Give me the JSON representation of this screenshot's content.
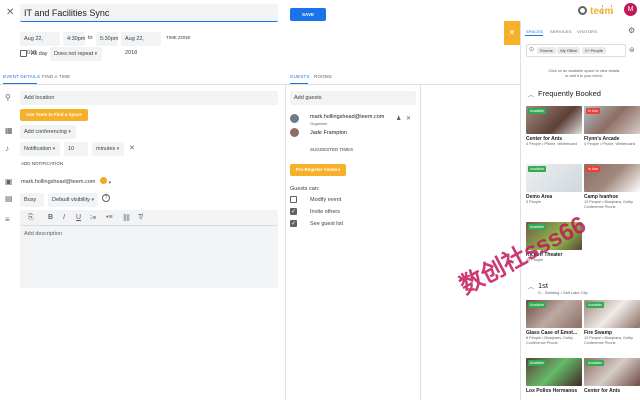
{
  "event": {
    "title": "IT and Facilities Sync",
    "save_label": "SAVE",
    "start_date": "Aug 22, 2018",
    "start_time": "4:30pm",
    "to_label": "to",
    "end_time": "5:30pm",
    "end_date": "Aug 22, 2018",
    "timezone_label": "TIME ZONE",
    "allday_label": "All day",
    "repeat_value": "Does not repeat"
  },
  "left_tabs": [
    "EVENT DETAILS",
    "FIND A TIME"
  ],
  "details": {
    "location_placeholder": "Add location",
    "teem_button": "Use Teem to Find a Space",
    "conferencing": "Add conferencing",
    "notification_type": "Notification",
    "notification_value": "10",
    "notification_unit": "minutes",
    "add_notification": "ADD NOTIFICATION",
    "calendar_owner": "mark.hollingshead@teem.com",
    "busy": "Busy",
    "visibility": "Default visibility",
    "description_placeholder": "Add description"
  },
  "middle_tabs": [
    "GUESTS",
    "ROOMS"
  ],
  "guests": {
    "add_placeholder": "Add guests",
    "list": [
      {
        "name": "mark.hollingshead@teem.com",
        "role": "Organizer"
      },
      {
        "name": "Jade Frampton",
        "role": ""
      }
    ],
    "suggested_times": "SUGGESTED TIMES",
    "preregister": "Pre-Register Visitors",
    "can_label": "Guests can:",
    "permissions": [
      {
        "label": "Modify event",
        "checked": false
      },
      {
        "label": "Invite others",
        "checked": true
      },
      {
        "label": "See guest list",
        "checked": true
      }
    ]
  },
  "header": {
    "avatar_letter": "M",
    "teem_logo": "teem"
  },
  "teem": {
    "tabs": [
      "SPACES",
      "SERVICES",
      "VISITORS"
    ],
    "filters": [
      "Rooms",
      "My Office",
      "2+ People"
    ],
    "hint": "Click on an available space to view details or add it to your event.",
    "frequently_booked": "Frequently Booked",
    "floor_label": "1st",
    "floor_sub": "S... Building • Salt Lake City",
    "cards": [
      {
        "name": "Center for Ants",
        "status": "Available",
        "meta": "4 People • Phone, Whiteboard"
      },
      {
        "name": "Flynn's Arcade",
        "status": "In Use",
        "meta": "4 People • Phone, Whiteboard"
      },
      {
        "name": "Demo Area",
        "status": "Available",
        "meta": "5 People"
      },
      {
        "name": "Camp Ivanhoe",
        "status": "In Use",
        "meta": "12 People • Bluejeans, Dolby Conference Phone"
      },
      {
        "name": "Kickoff Theater",
        "status": "Available",
        "meta": "25 People"
      },
      {
        "name": "Glass Case of Emot...",
        "status": "Available",
        "meta": "8 People • Bluejeans, Dolby Conference Phone"
      },
      {
        "name": "Fire Swamp",
        "status": "Available",
        "meta": "12 People • Bluejeans, Dolby Conference Phone"
      },
      {
        "name": "Los Pollos Hermanos",
        "status": "Available",
        "meta": ""
      },
      {
        "name": "Center for Ants",
        "status": "Available",
        "meta": ""
      }
    ]
  },
  "watermark": "数创社sss66",
  "colors": {
    "accent": "#1a73e8",
    "teem_yellow": "#f6b02a",
    "available": "#34a853",
    "in_use": "#ea4335"
  }
}
